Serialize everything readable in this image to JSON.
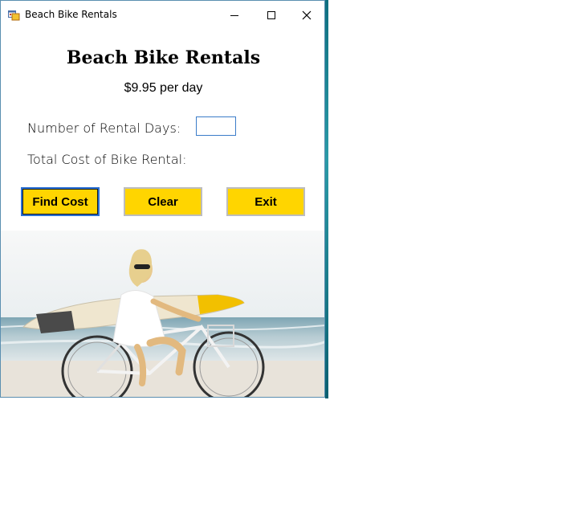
{
  "window": {
    "title": "Beach Bike Rentals",
    "icon": "app-form-icon",
    "controls": {
      "minimize": "minimize-icon",
      "maximize": "maximize-icon",
      "close": "close-icon"
    }
  },
  "form": {
    "heading": "Beach Bike Rentals",
    "price_text": "$9.95 per day",
    "days_label": "Number of Rental Days:",
    "days_value": "",
    "total_label": "Total Cost of Bike Rental:",
    "total_value": ""
  },
  "buttons": {
    "find_cost": "Find Cost",
    "clear": "Clear",
    "exit": "Exit"
  },
  "colors": {
    "button_bg": "#ffd500",
    "focus_border": "#2a6fd1",
    "desktop_accent": "#0e6f80"
  }
}
